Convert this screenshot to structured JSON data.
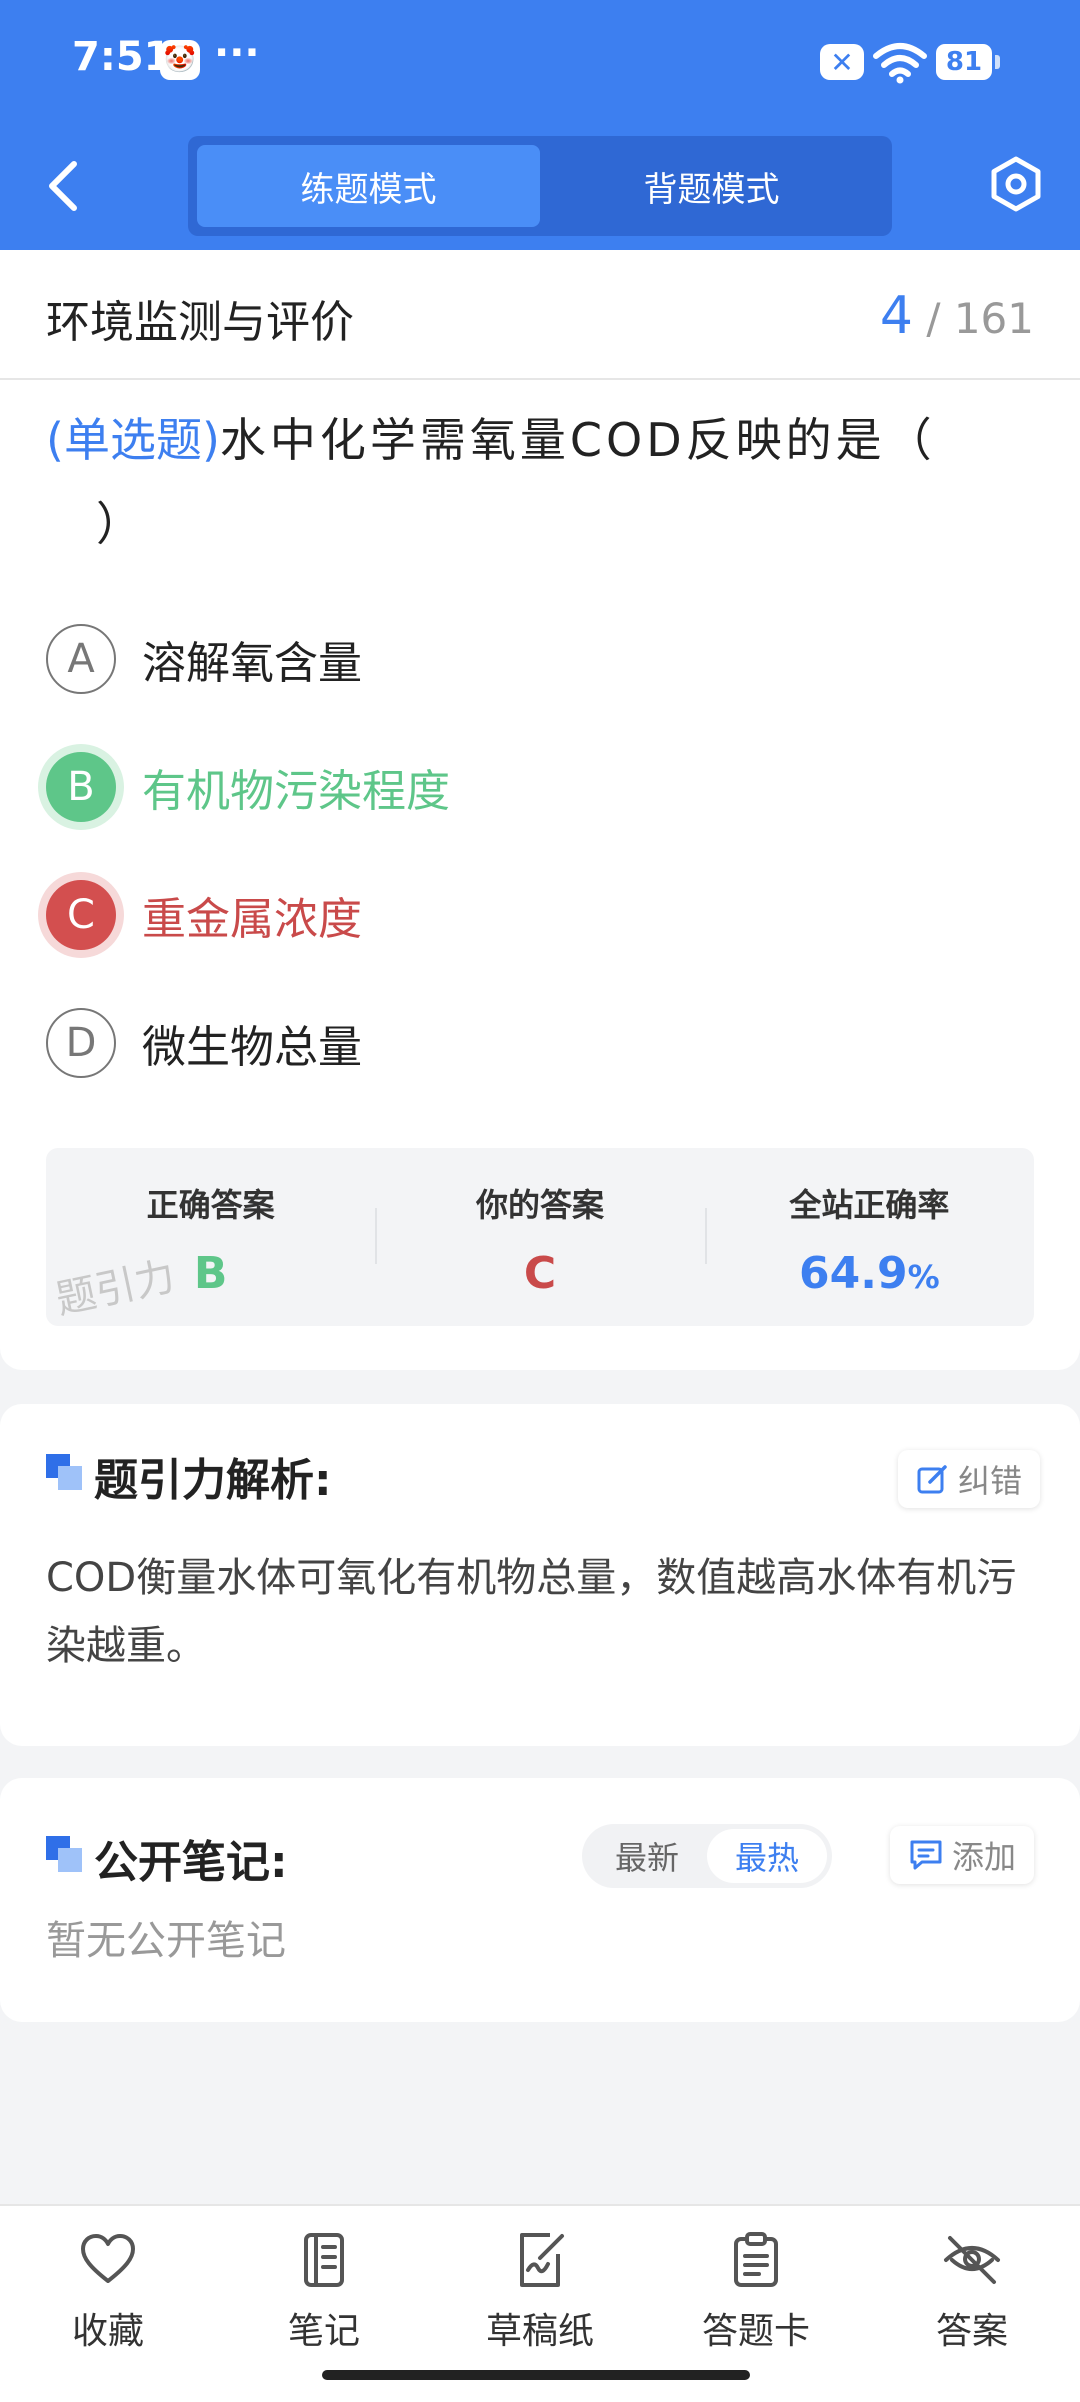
{
  "status_bar": {
    "time": "7:51",
    "app_icon": "🤡",
    "dots": "···",
    "notification": "✕",
    "battery": "81"
  },
  "header": {
    "modes": [
      "练题模式",
      "背题模式"
    ],
    "active_mode": "练题模式"
  },
  "question_card": {
    "subject": "环境监测与评价",
    "progress_current": "4",
    "progress_total": "/ 161",
    "question_type": "(单选题)",
    "question_text": "水中化学需氧量COD反映的是（",
    "question_tail": "）",
    "options": [
      {
        "letter": "A",
        "text": "溶解氧含量",
        "state": "normal"
      },
      {
        "letter": "B",
        "text": "有机物污染程度",
        "state": "correct"
      },
      {
        "letter": "C",
        "text": "重金属浓度",
        "state": "wrong"
      },
      {
        "letter": "D",
        "text": "微生物总量",
        "state": "normal"
      }
    ],
    "result": {
      "correct_label": "正确答案",
      "correct_value": "B",
      "yours_label": "你的答案",
      "yours_value": "C",
      "rate_label": "全站正确率",
      "rate_value": "64.9",
      "rate_unit": "%",
      "watermark": "题引力"
    }
  },
  "analysis": {
    "title": "题引力解析:",
    "report_label": "纠错",
    "text": "COD衡量水体可氧化有机物总量，数值越高水体有机污染越重。"
  },
  "notes": {
    "title": "公开笔记:",
    "sort_options": [
      "最新",
      "最热"
    ],
    "active_sort": "最热",
    "add_label": "添加",
    "empty_text": "暂无公开笔记"
  },
  "bottom_nav": [
    {
      "label": "收藏",
      "icon": "heart-icon"
    },
    {
      "label": "笔记",
      "icon": "notebook-icon"
    },
    {
      "label": "草稿纸",
      "icon": "draft-icon"
    },
    {
      "label": "答题卡",
      "icon": "clipboard-icon"
    },
    {
      "label": "答案",
      "icon": "eye-off-icon"
    }
  ],
  "colors": {
    "primary": "#3d7ff0",
    "correct": "#5ec689",
    "wrong": "#d34f4f"
  }
}
